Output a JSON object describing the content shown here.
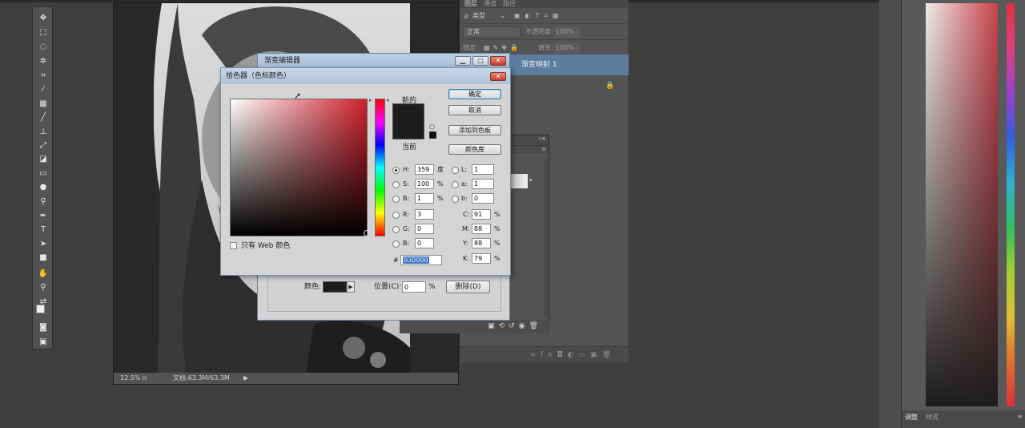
{
  "document": {
    "zoom": "12.5%",
    "doc_info": "文档:63.3M/63.3M"
  },
  "layers_panel": {
    "tabs": [
      "图层",
      "通道",
      "路径"
    ],
    "kind_filter": "类型",
    "blend_mode": "正常",
    "opacity_label": "不透明度:",
    "opacity_value": "100%",
    "lock_label": "锁定:",
    "fill_label": "填充:",
    "fill_value": "100%",
    "layer_name": "渐变映射 1"
  },
  "gradient_editor": {
    "title": "渐变编辑器",
    "color_label": "颜色:",
    "position_label": "位置(C):",
    "position_value": "0",
    "position_unit": "%",
    "delete_label": "删除(D)"
  },
  "color_picker": {
    "title": "拾色器（色标颜色）",
    "new_label": "新的",
    "current_label": "当前",
    "ok_label": "确定",
    "cancel_label": "取消",
    "add_swatch_label": "添加到色板",
    "libraries_label": "颜色库",
    "web_only_label": "只有 Web 颜色",
    "new_color": "#1d1d1d",
    "current_color": "#1d1d1d",
    "fields": {
      "h": {
        "label": "H:",
        "value": "359",
        "unit": "度"
      },
      "s": {
        "label": "S:",
        "value": "100",
        "unit": "%"
      },
      "b": {
        "label": "B:",
        "value": "1",
        "unit": "%"
      },
      "r": {
        "label": "R:",
        "value": "3"
      },
      "g": {
        "label": "G:",
        "value": "0"
      },
      "bb": {
        "label": "B:",
        "value": "0"
      },
      "l": {
        "label": "L:",
        "value": "1"
      },
      "a": {
        "label": "a:",
        "value": "1"
      },
      "lb": {
        "label": "b:",
        "value": "0"
      },
      "c": {
        "label": "C:",
        "value": "91",
        "unit": "%"
      },
      "m": {
        "label": "M:",
        "value": "88",
        "unit": "%"
      },
      "y": {
        "label": "Y:",
        "value": "88",
        "unit": "%"
      },
      "k": {
        "label": "K:",
        "value": "79",
        "unit": "%"
      },
      "hex": {
        "label": "#",
        "value": "030000"
      }
    }
  },
  "right_panel": {
    "tabs": [
      "调整",
      "样式"
    ]
  },
  "colors": {
    "accent": "#5c7d9e",
    "hex_selection": "#3b73c0"
  }
}
